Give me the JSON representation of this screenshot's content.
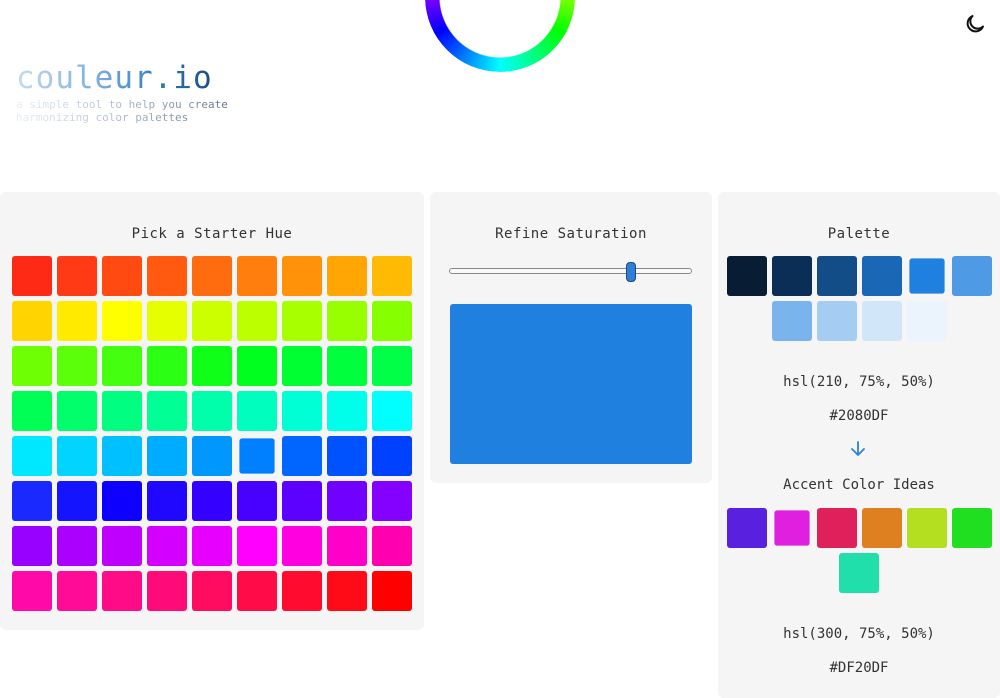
{
  "brand": {
    "title": "couleur.io",
    "tagline": "a simple tool to help you create harmonizing color palettes"
  },
  "icons": {
    "logo": "color-wheel-ring-icon",
    "theme": "moon-icon",
    "arrow": "arrow-down-icon"
  },
  "hue_panel": {
    "title": "Pick a Starter Hue",
    "selected_index": 41,
    "colors": [
      "#ff2a16",
      "#ff3a14",
      "#ff4a12",
      "#ff5a10",
      "#ff6c0f",
      "#ff7e0d",
      "#ff9209",
      "#ffa605",
      "#ffbb04",
      "#ffd400",
      "#ffea00",
      "#ffff00",
      "#e6ff00",
      "#ccff00",
      "#bbff00",
      "#a8ff00",
      "#98ff00",
      "#86ff00",
      "#6eff05",
      "#5cff0a",
      "#44ff0f",
      "#2aff14",
      "#10ff19",
      "#00ff1e",
      "#00ff32",
      "#00ff3c",
      "#00ff46",
      "#00ff55",
      "#00ff6b",
      "#00ff80",
      "#00ff95",
      "#00ffaa",
      "#00ffbf",
      "#00ffd5",
      "#00ffea",
      "#00ffff",
      "#00e8ff",
      "#00d4ff",
      "#00c0ff",
      "#00acff",
      "#0098ff",
      "#0080ff",
      "#0066ff",
      "#0052ff",
      "#0040ff",
      "#1a2aff",
      "#1414ff",
      "#0e00ff",
      "#2008ff",
      "#3400ff",
      "#4800ff",
      "#5c00ff",
      "#7000ff",
      "#8400ff",
      "#9800ff",
      "#ac00ff",
      "#c000ff",
      "#d400ff",
      "#e800ff",
      "#ff00ff",
      "#ff00e0",
      "#ff00c8",
      "#ff00b0",
      "#ff0aa8",
      "#ff0b98",
      "#ff0b88",
      "#ff0b78",
      "#ff0b60",
      "#ff0b48",
      "#ff0b30",
      "#ff0b18",
      "#ff0000"
    ]
  },
  "saturation_panel": {
    "title": "Refine Saturation",
    "saturation_percent": 75,
    "preview_color": "#2080DF"
  },
  "palette_panel": {
    "title": "Palette",
    "selected_index": 4,
    "swatches": [
      "#081c33",
      "#0b2e57",
      "#124d87",
      "#1a67b5",
      "#2080df",
      "#4f9ae5",
      "#7ab4ec",
      "#a5cdf2",
      "#d2e6f9",
      "#ebf3fc"
    ],
    "hsl": "hsl(210, 75%, 50%)",
    "hex": "#2080DF"
  },
  "accent_panel": {
    "title": "Accent Color Ideas",
    "selected_index": 1,
    "swatches": [
      "#5a20df",
      "#df20df",
      "#df205a",
      "#df8020",
      "#b3df20",
      "#20df20",
      "#20dfaa"
    ],
    "hsl": "hsl(300, 75%, 50%)",
    "hex": "#DF20DF"
  }
}
